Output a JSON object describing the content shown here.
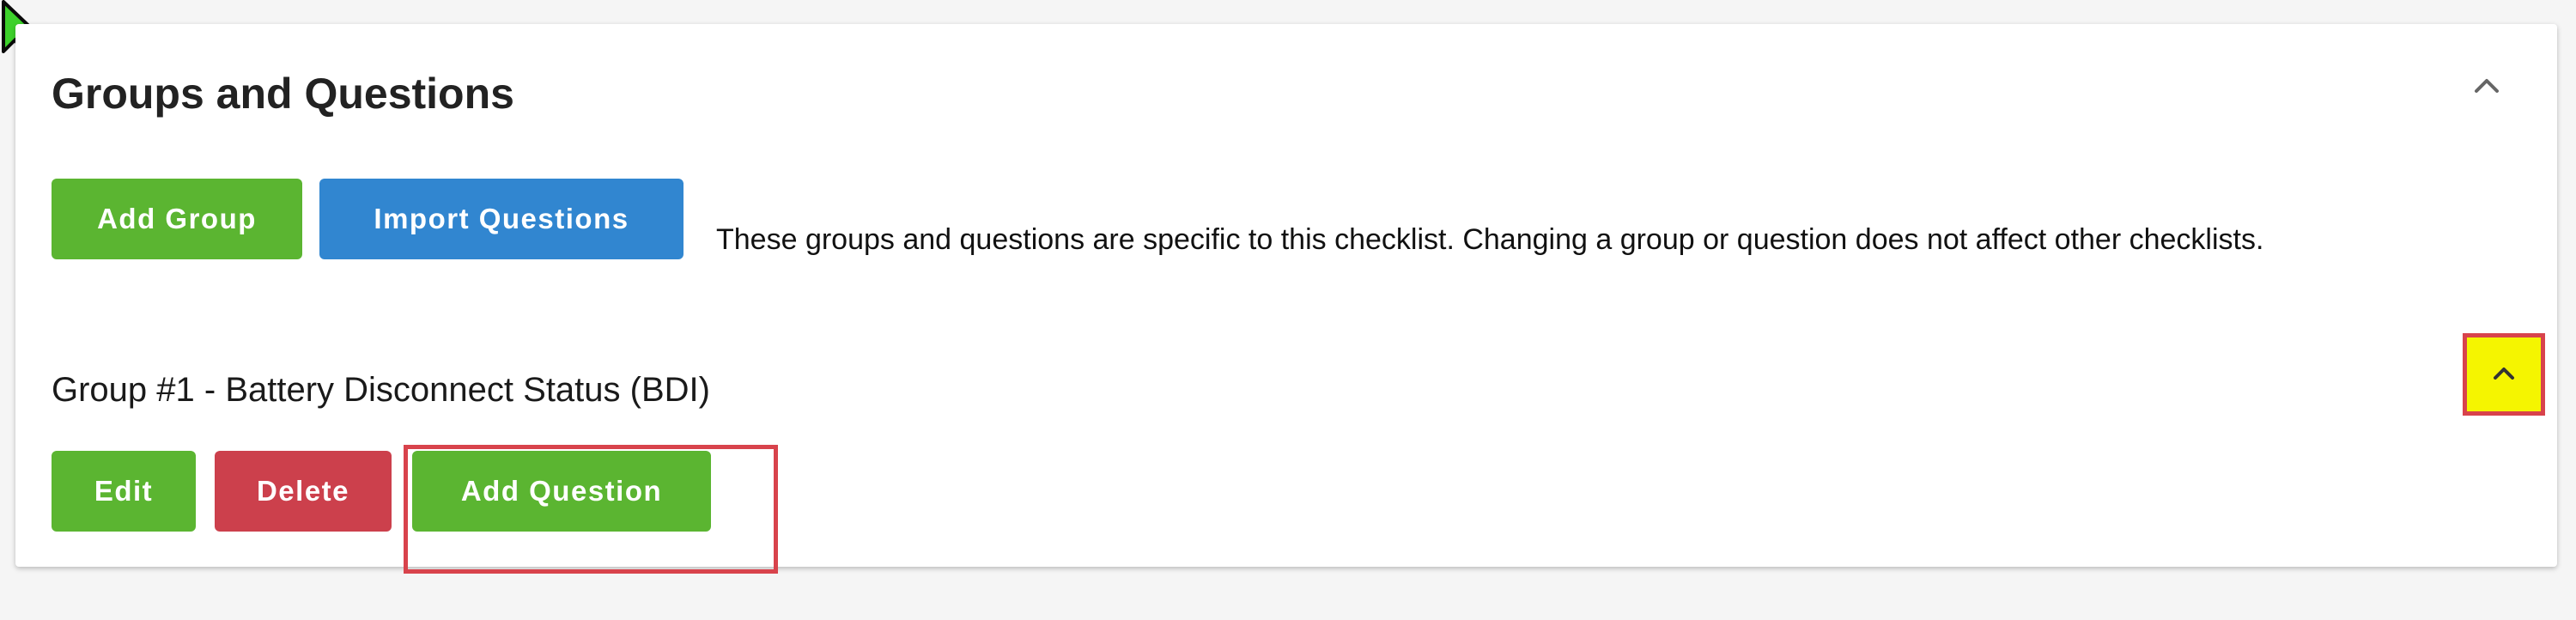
{
  "card": {
    "title": "Groups and Questions",
    "collapse_icon": "chevron-up-icon"
  },
  "toolbar": {
    "add_group_label": "Add Group",
    "import_questions_label": "Import Questions",
    "info_text": "These groups and questions are specific to this checklist. Changing a group or question does not affect other checklists."
  },
  "group": {
    "title": "Group #1 - Battery Disconnect Status (BDI)",
    "toggle_icon": "chevron-up-icon",
    "edit_label": "Edit",
    "delete_label": "Delete",
    "add_question_label": "Add Question"
  },
  "colors": {
    "green": "#5bb531",
    "blue": "#3186d0",
    "red": "#cc404c",
    "highlight_border": "#d8434c",
    "highlight_fill": "#f5f500"
  },
  "cursor_icon": "pointer-cursor-icon"
}
